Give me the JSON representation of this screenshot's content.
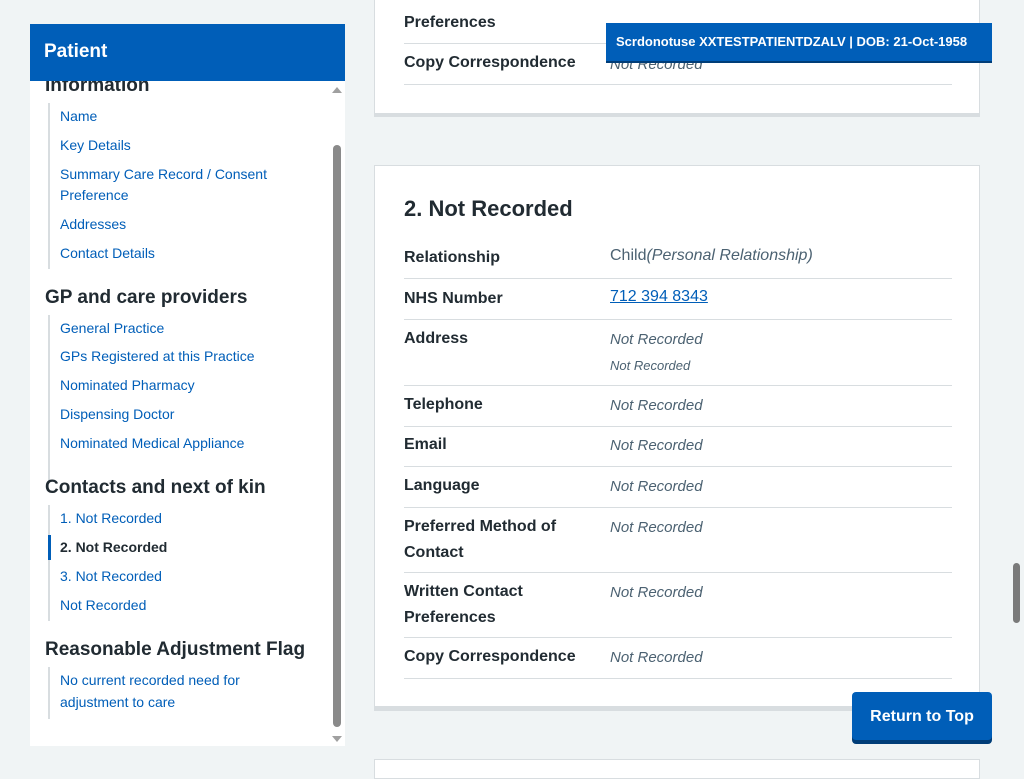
{
  "nav": {
    "header": "Patient",
    "group_patient_info": "Information",
    "patient_info_links": [
      "Name",
      "Key Details",
      "Summary Care Record / Consent",
      "Preference",
      "Addresses",
      "Contact Details"
    ],
    "group_gp": "GP and care providers",
    "gp_links": [
      "General Practice",
      "GPs Registered at this Practice",
      "Nominated Pharmacy",
      "Dispensing Doctor",
      "Nominated Medical Appliance"
    ],
    "group_contacts": "Contacts and next of kin",
    "contact_links": [
      "1. Not Recorded",
      "2. Not Recorded",
      "3. Not Recorded",
      "Not Recorded"
    ],
    "group_raf": "Reasonable Adjustment Flag",
    "raf_links": [
      "No current recorded need for",
      "adjustment to care"
    ]
  },
  "banner": {
    "text": "Scrdonotuse XXTESTPATIENTDZALV | DOB: 21-Oct-1958"
  },
  "prev_card": {
    "rows": [
      {
        "label": "Preferences",
        "value": ""
      },
      {
        "label": "Copy Correspondence",
        "value": "Not Recorded"
      }
    ]
  },
  "card": {
    "title": "2. Not Recorded",
    "relationship_label": "Relationship",
    "relationship_value": "Child",
    "relationship_type": "(Personal Relationship)",
    "nhs_label": "NHS Number",
    "nhs_value": "712 394 8343",
    "address_label": "Address",
    "address_value_1": "Not Recorded",
    "address_value_2": "Not Recorded",
    "telephone_label": "Telephone",
    "telephone_value": "Not Recorded",
    "email_label": "Email",
    "email_value": "Not Recorded",
    "language_label": "Language",
    "language_value": "Not Recorded",
    "pref_method_label_1": "Preferred Method of",
    "pref_method_label_2": "Contact",
    "pref_method_value": "Not Recorded",
    "written_label_1": "Written Contact",
    "written_label_2": "Preferences",
    "written_value": "Not Recorded",
    "copy_label": "Copy Correspondence",
    "copy_value": "Not Recorded"
  },
  "return_top": "Return to Top",
  "colors": {
    "nhs_blue": "#005eb8",
    "page_bg": "#f0f4f5",
    "text": "#212b32",
    "secondary_text": "#4c6272",
    "border": "#d8dde0"
  }
}
